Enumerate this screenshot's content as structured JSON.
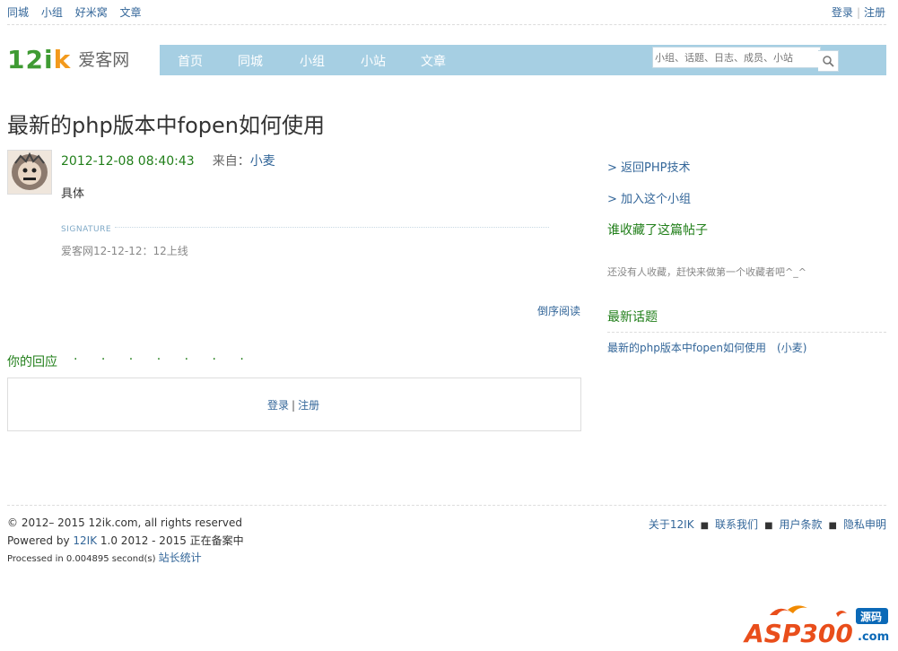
{
  "topbar": {
    "links": [
      "同城",
      "小组",
      "好米窝",
      "文章"
    ],
    "login": "登录",
    "register": "注册"
  },
  "logo": {
    "mark_a": "12i",
    "mark_b": "k",
    "text": "爱客网"
  },
  "nav": {
    "items": [
      "首页",
      "同城",
      "小组",
      "小站",
      "文章"
    ],
    "search_placeholder": "小组、话题、日志、成员、小站"
  },
  "post": {
    "title": "最新的php版本中fopen如何使用",
    "date": "2012-12-08 08:40:43",
    "from_label": "来自：",
    "author": "小麦",
    "body": "具体",
    "signature_label": "SIGNATURE",
    "signature_text": "爱客网12-12-12：12上线",
    "reverse_read": "倒序阅读"
  },
  "reply": {
    "heading": "你的回应",
    "dots": "· · · · · · ·",
    "login": "登录",
    "register": "注册"
  },
  "sidebar": {
    "back_link": "> 返回PHP技术",
    "join_link": "> 加入这个小组",
    "fav_heading": "谁收藏了这篇帖子",
    "fav_empty": "还没有人收藏，赶快来做第一个收藏者吧^_^",
    "latest_heading": "最新话题",
    "latest_topic": "最新的php版本中fopen如何使用",
    "latest_author": "(小麦)"
  },
  "footer": {
    "copyright": "© 2012– 2015 12ik.com, all rights reserved",
    "powered_prefix": "Powered by",
    "powered_link": "12IK",
    "powered_suffix": "1.0 2012 - 2015 正在备案中",
    "processed": "Processed in 0.004895 second(s)",
    "stats_link": "站长统计",
    "links": [
      "关于12IK",
      "联系我们",
      "用户条款",
      "隐私申明"
    ]
  },
  "watermark": {
    "text": "ASP300",
    "badge": "源码",
    "url": ".com"
  },
  "colors": {
    "nav_bg": "#a6cfe3",
    "link": "#336699",
    "green": "#217f1a",
    "logo_green": "#3f9b33",
    "logo_orange": "#f39a1c"
  }
}
